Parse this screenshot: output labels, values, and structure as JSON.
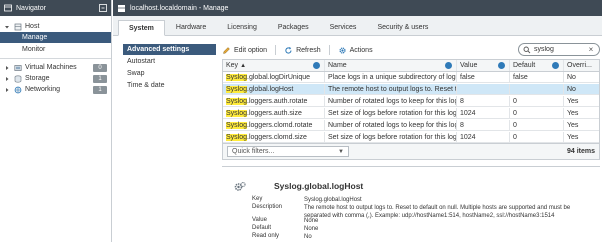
{
  "navigator": {
    "title": "Navigator",
    "items": [
      {
        "label": "Host"
      },
      {
        "label": "Manage"
      },
      {
        "label": "Monitor"
      },
      {
        "label": "Virtual Machines",
        "count": "0"
      },
      {
        "label": "Storage",
        "count": "1"
      },
      {
        "label": "Networking",
        "count": "1"
      }
    ]
  },
  "window": {
    "title": "localhost.localdomain - Manage"
  },
  "tabs": [
    "System",
    "Hardware",
    "Licensing",
    "Packages",
    "Services",
    "Security & users"
  ],
  "settings_menu": [
    "Advanced settings",
    "Autostart",
    "Swap",
    "Time & date"
  ],
  "toolbar": {
    "edit": "Edit option",
    "refresh": "Refresh",
    "actions": "Actions"
  },
  "search": {
    "value": "syslog"
  },
  "grid": {
    "columns": [
      "Key",
      "Name",
      "Value",
      "Default",
      "Overri..."
    ],
    "rows": [
      {
        "key_hl": "Syslog",
        "key_rest": ".global.logDirUnique",
        "name": "Place logs in a unique subdirectory of logdir, b...",
        "value": "false",
        "default": "false",
        "override": "No"
      },
      {
        "key_hl": "Syslog",
        "key_rest": ".global.logHost",
        "name": "The remote host to output logs to. Reset to de...",
        "value": "",
        "default": "",
        "override": "No"
      },
      {
        "key_hl": "Syslog",
        "key_rest": ".loggers.auth.rotate",
        "name": "Number of rotated logs to keep for this logger. ...",
        "value": "8",
        "default": "0",
        "override": "Yes"
      },
      {
        "key_hl": "Syslog",
        "key_rest": ".loggers.auth.size",
        "name": "Set size of logs before rotation for this logger, i...",
        "value": "1024",
        "default": "0",
        "override": "Yes"
      },
      {
        "key_hl": "Syslog",
        "key_rest": ".loggers.clomd.rotate",
        "name": "Number of rotated logs to keep for this logger. ...",
        "value": "8",
        "default": "0",
        "override": "Yes"
      },
      {
        "key_hl": "Syslog",
        "key_rest": ".loggers.clomd.size",
        "name": "Set size of logs before rotation for this logger, i...",
        "value": "1024",
        "default": "0",
        "override": "Yes"
      }
    ],
    "quick_filters": "Quick filters...",
    "item_count": "94 items"
  },
  "details": {
    "title": "Syslog.global.logHost",
    "fields": [
      {
        "label": "Key",
        "value": "Syslog.global.logHost"
      },
      {
        "label": "Description",
        "value": "The remote host to output logs to. Reset to default on null. Multiple hosts are supported and must be separated with comma (,). Example: udp://hostName1:514, hostName2, ssl://hostName3:1514"
      },
      {
        "label": "Value",
        "value": "None"
      },
      {
        "label": "Default",
        "value": "None"
      },
      {
        "label": "Read only",
        "value": "No"
      }
    ]
  },
  "colors": {
    "header_dark": "#3f4a55",
    "selected_nav": "#3b5a7c",
    "row_selected": "#cfe7f7",
    "highlight": "#ffeb3b",
    "accent_blue": "#2f7ab8"
  }
}
